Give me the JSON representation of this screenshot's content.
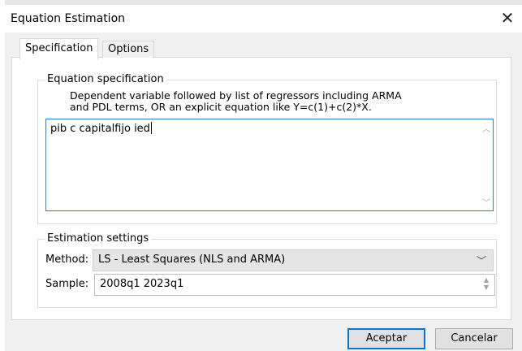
{
  "window": {
    "title": "Equation Estimation",
    "close_glyph": "✕"
  },
  "tabs": [
    {
      "label": "Specification",
      "active": true
    },
    {
      "label": "Options",
      "active": false
    }
  ],
  "equation": {
    "group_label": "Equation specification",
    "description_line1": "Dependent variable followed by list of regressors including ARMA",
    "description_line2": "and PDL terms, OR an explicit equation like Y=c(1)+c(2)*X.",
    "value": "pib c capitalfijo ied"
  },
  "estimation": {
    "group_label": "Estimation settings",
    "method_label": "Method:",
    "method_value": "LS  -  Least Squares (NLS and ARMA)",
    "sample_label": "Sample:",
    "sample_value": "2008q1 2023q1"
  },
  "buttons": {
    "ok": "Aceptar",
    "cancel": "Cancelar"
  },
  "icons": {
    "close": "close-icon",
    "scroll_up": "chevron-up-icon",
    "scroll_down": "chevron-down-icon",
    "dropdown": "chevron-down-icon",
    "spinner": "spinner-icon"
  },
  "colors": {
    "focus_border": "#2e7fd6",
    "default_button_border": "#0078d7",
    "dialog_bg": "#f0f0f0"
  }
}
